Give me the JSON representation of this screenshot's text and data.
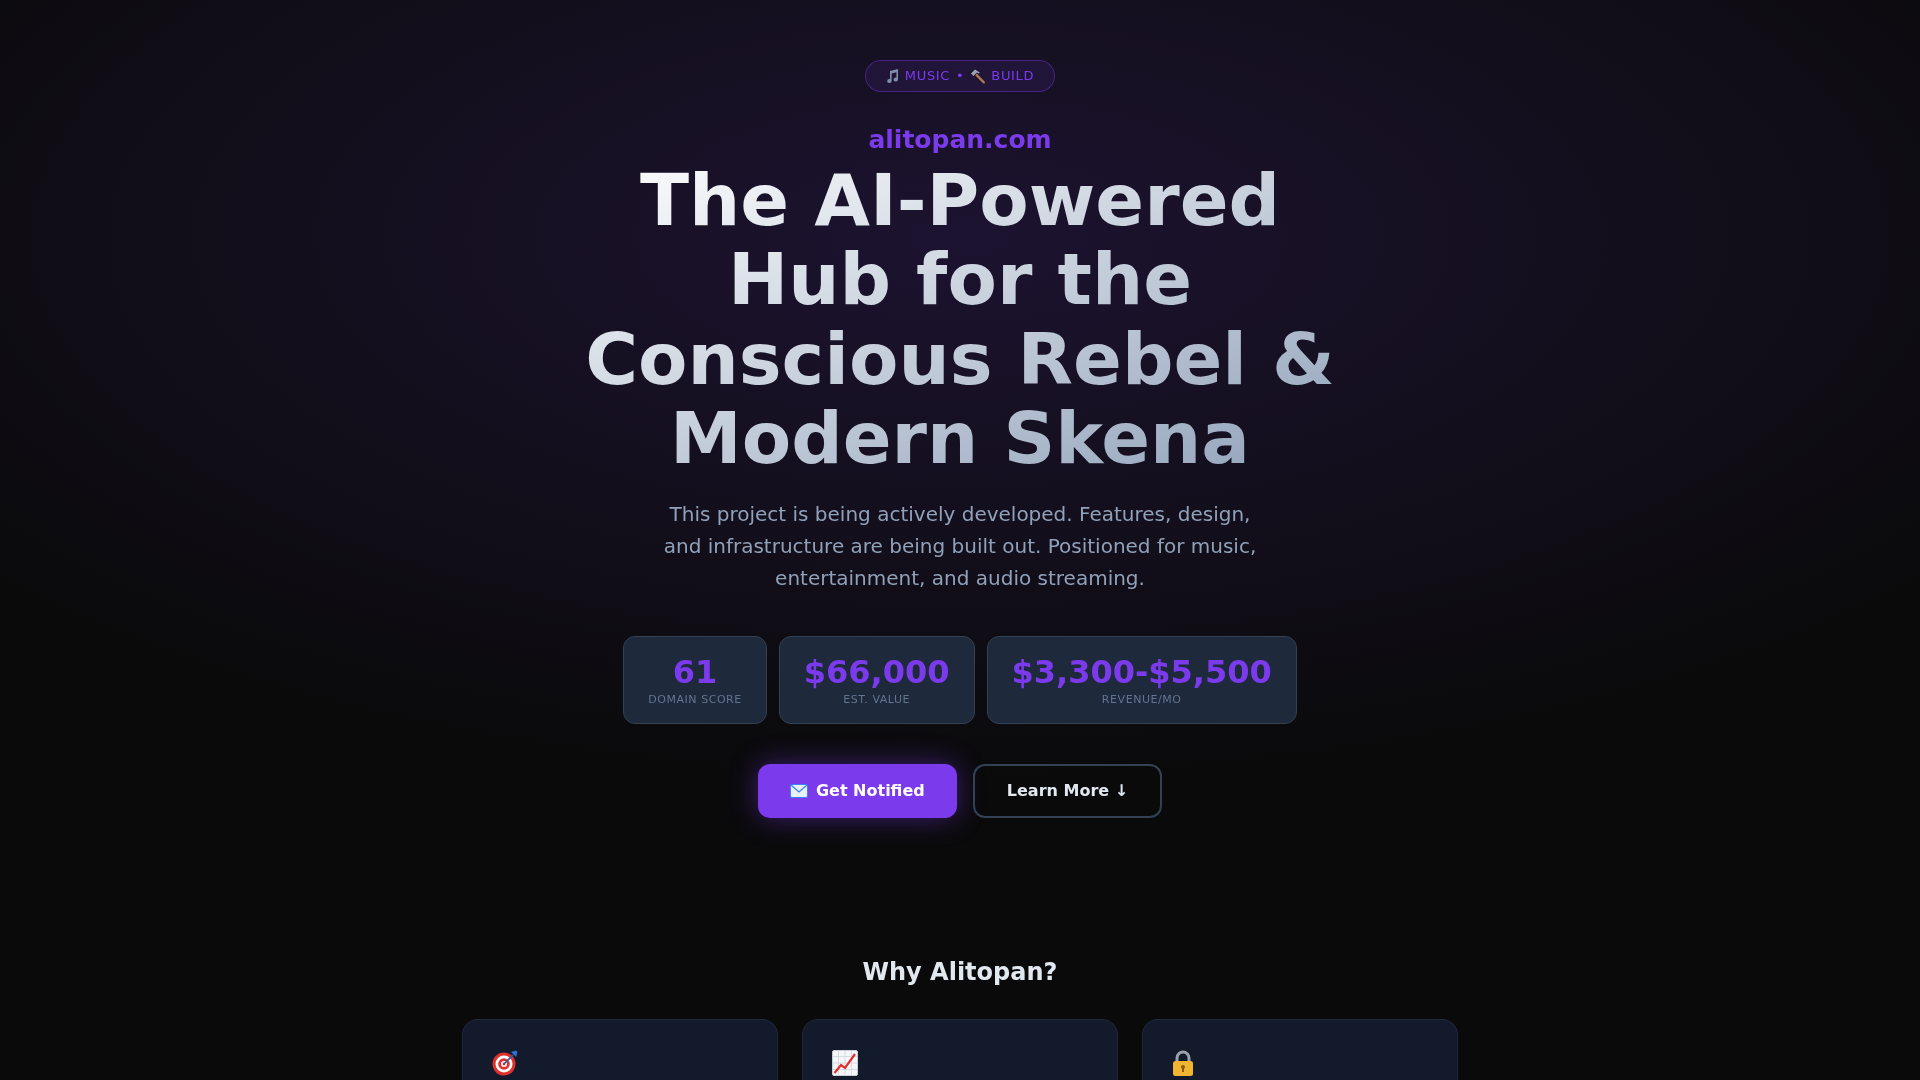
{
  "hero": {
    "badge": {
      "left": "MUSIC",
      "separator": "•",
      "right": "BUILD"
    },
    "domain": "alitopan.com",
    "title": "The AI-Powered Hub for the Conscious Rebel & Modern Skena",
    "description": "This project is being actively developed. Features, design, and infrastructure are being built out. Positioned for music, entertainment, and audio streaming.",
    "stats": [
      {
        "value": "61",
        "label": "DOMAIN SCORE"
      },
      {
        "value": "$66,000",
        "label": "EST. VALUE"
      },
      {
        "value": "$3,300-$5,500",
        "label": "REVENUE/MO"
      }
    ],
    "buttons": [
      {
        "label": "Get Notified",
        "kind": "primary"
      },
      {
        "label": "Learn More ↓",
        "kind": "secondary"
      }
    ]
  },
  "why_section": {
    "heading": "Why Alitopan?"
  }
}
